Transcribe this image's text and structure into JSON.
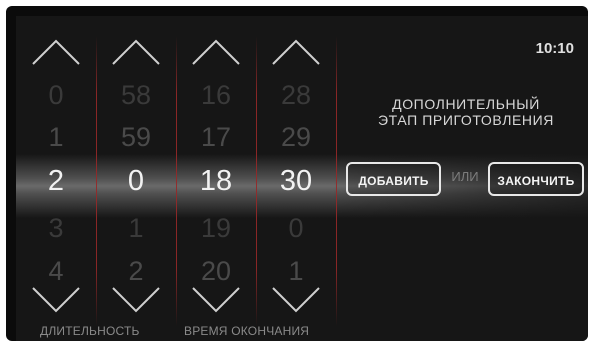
{
  "status_bar": {
    "clock": "10:10"
  },
  "icons": {
    "up": "chevron-up-icon",
    "down": "chevron-down-icon"
  },
  "colors": {
    "screen_background": "#161616",
    "selected_value": "#f2f2f2",
    "dim_value": "#3a3a3a",
    "divider_red": "#962828",
    "button_border": "#e8e8e8"
  },
  "pickers": [
    {
      "name": "duration-hours",
      "values": [
        "0",
        "1",
        "2",
        "3",
        "4"
      ],
      "selected_index": 2
    },
    {
      "name": "duration-minutes",
      "values": [
        "58",
        "59",
        "0",
        "1",
        "2"
      ],
      "selected_index": 2
    },
    {
      "name": "end-hours",
      "values": [
        "16",
        "17",
        "18",
        "19",
        "20"
      ],
      "selected_index": 2
    },
    {
      "name": "end-minutes",
      "values": [
        "28",
        "29",
        "30",
        "0",
        "1"
      ],
      "selected_index": 2
    }
  ],
  "labels": {
    "duration": "ДЛИТЕЛЬНОСТЬ",
    "end_time": "ВРЕМЯ ОКОНЧАНИЯ"
  },
  "prompt": {
    "line1": "ДОПОЛНИТЕЛЬНЫЙ",
    "line2": "ЭТАП ПРИГОТОВЛЕНИЯ"
  },
  "actions": {
    "add_label": "ДОБАВИТЬ",
    "or_label": "ИЛИ",
    "finish_label": "ЗАКОНЧИТЬ"
  }
}
